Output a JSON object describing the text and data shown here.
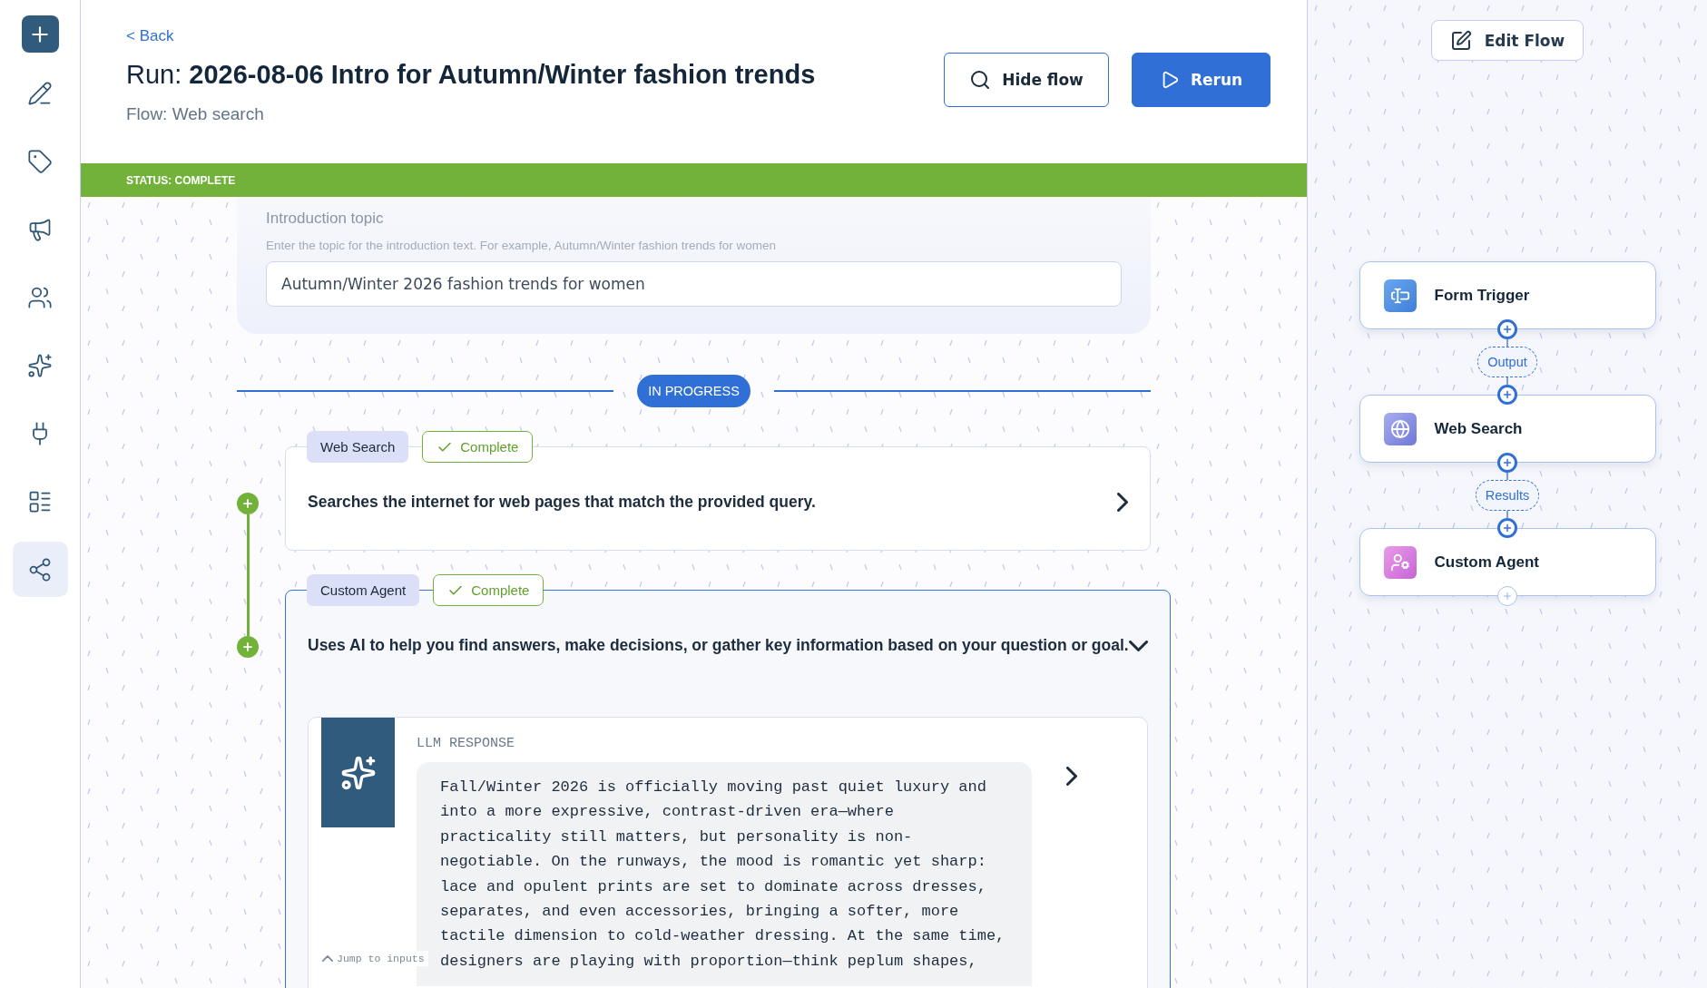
{
  "sidebar": {
    "items": [
      {
        "selected": false
      },
      {
        "selected": false
      },
      {
        "selected": false
      },
      {
        "selected": false
      },
      {
        "selected": false
      },
      {
        "selected": false
      },
      {
        "selected": false
      },
      {
        "selected": true
      }
    ]
  },
  "header": {
    "back": "< Back",
    "title_prefix": "Run:",
    "title": "2026-08-06 Intro for Autumn/Winter fashion trends",
    "flow": "Flow: Web search",
    "hide_flow": "Hide flow",
    "rerun": "Rerun"
  },
  "status_bar": "STATUS: COMPLETE",
  "form": {
    "label": "Introduction topic",
    "help": "Enter the topic for the introduction text. For example, Autumn/Winter fashion trends for women",
    "value": "Autumn/Winter 2026 fashion trends for women"
  },
  "divider": "IN PROGRESS",
  "steps": [
    {
      "name": "Web Search",
      "status": "Complete",
      "description": "Searches the internet for web pages that match the provided query.",
      "expanded": false
    },
    {
      "name": "Custom Agent",
      "status": "Complete",
      "description": "Uses AI to help you find answers, make decisions, or gather key information based on your question or goal.",
      "expanded": true,
      "response": {
        "label": "LLM RESPONSE",
        "text": "Fall/Winter 2026 is officially moving past quiet luxury and into a more expressive, contrast-driven era—where practicality still matters, but personality is non-negotiable. On the runways, the mood is romantic yet sharp: lace and opulent prints are set to dominate across dresses, separates, and even accessories, bringing a softer, more tactile dimension to cold-weather dressing. At the same time, designers are playing with proportion—think peplum shapes,"
      }
    }
  ],
  "jump": "Jump to inputs",
  "flow_panel": {
    "edit": "Edit Flow",
    "nodes": [
      {
        "kind": "form",
        "name": "Form Trigger"
      },
      {
        "kind": "search",
        "name": "Web Search"
      },
      {
        "kind": "agent",
        "name": "Custom Agent"
      }
    ],
    "edges": [
      "Output",
      "Results"
    ]
  }
}
